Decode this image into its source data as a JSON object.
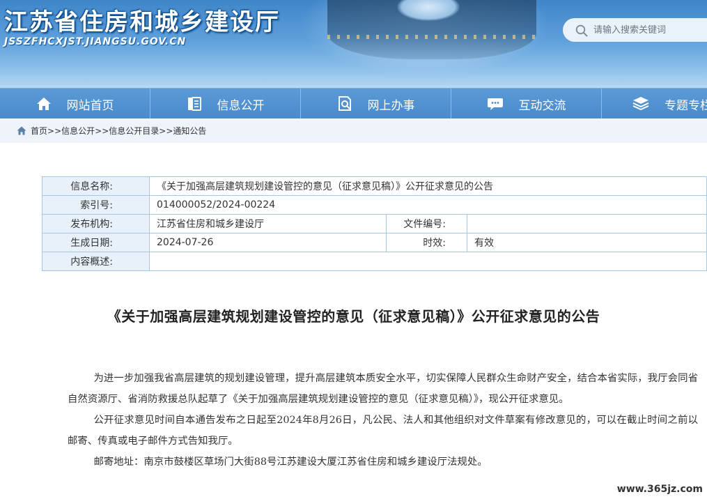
{
  "header": {
    "title": "江苏省住房和城乡建设厅",
    "domain": "JSSZFHCXJST.JIANGSU.GOV.CN",
    "search_placeholder": "请输入搜索关键词"
  },
  "nav": {
    "items": [
      {
        "label": "网站首页",
        "icon": "home-icon"
      },
      {
        "label": "信息公开",
        "icon": "document-icon"
      },
      {
        "label": "网上办事",
        "icon": "search-doc-icon"
      },
      {
        "label": "互动交流",
        "icon": "chat-icon"
      },
      {
        "label": "专题专栏",
        "icon": "layers-icon"
      }
    ]
  },
  "breadcrumb": {
    "items": [
      "首页",
      "信息公开",
      "信息公开目录",
      "通知公告"
    ],
    "separator": ">>"
  },
  "info": {
    "name_label": "信息名称:",
    "name_value": "《关于加强高层建筑规划建设管控的意见（征求意见稿）》公开征求意见的公告",
    "index_label": "索引号:",
    "index_value": "014000052/2024-00224",
    "publisher_label": "发布机构:",
    "publisher_value": "江苏省住房和城乡建设厅",
    "docno_label": "文件编号:",
    "docno_value": "",
    "date_label": "生成日期:",
    "date_value": "2024-07-26",
    "validity_label": "时效:",
    "validity_value": "有效",
    "summary_label": "内容概述:",
    "summary_value": ""
  },
  "article": {
    "title": "《关于加强高层建筑规划建设管控的意见（征求意见稿）》公开征求意见的公告",
    "paragraphs": [
      "为进一步加强我省高层建筑的规划建设管理，提升高层建筑本质安全水平，切实保障人民群众生命财产安全，结合本省实际，我厅会同省自然资源厅、省消防救援总队起草了《关于加强高层建筑规划建设管控的意见（征求意见稿）》，现公开征求意见。",
      "公开征求意见时间自本通告发布之日起至2024年8月26日，凡公民、法人和其他组织对文件草案有修改意见的，可以在截止时间之前以邮寄、传真或电子邮件方式告知我厅。",
      "邮寄地址：南京市鼓楼区草场门大街88号江苏建设大厦江苏省住房和城乡建设厅法规处。"
    ]
  },
  "watermark": "www.365jz.com",
  "colors": {
    "nav_bg": "#4a8acb",
    "table_border": "#a7c6e2",
    "label_bg": "#e8f1fa",
    "breadcrumb_bg": "#eef4fa"
  }
}
